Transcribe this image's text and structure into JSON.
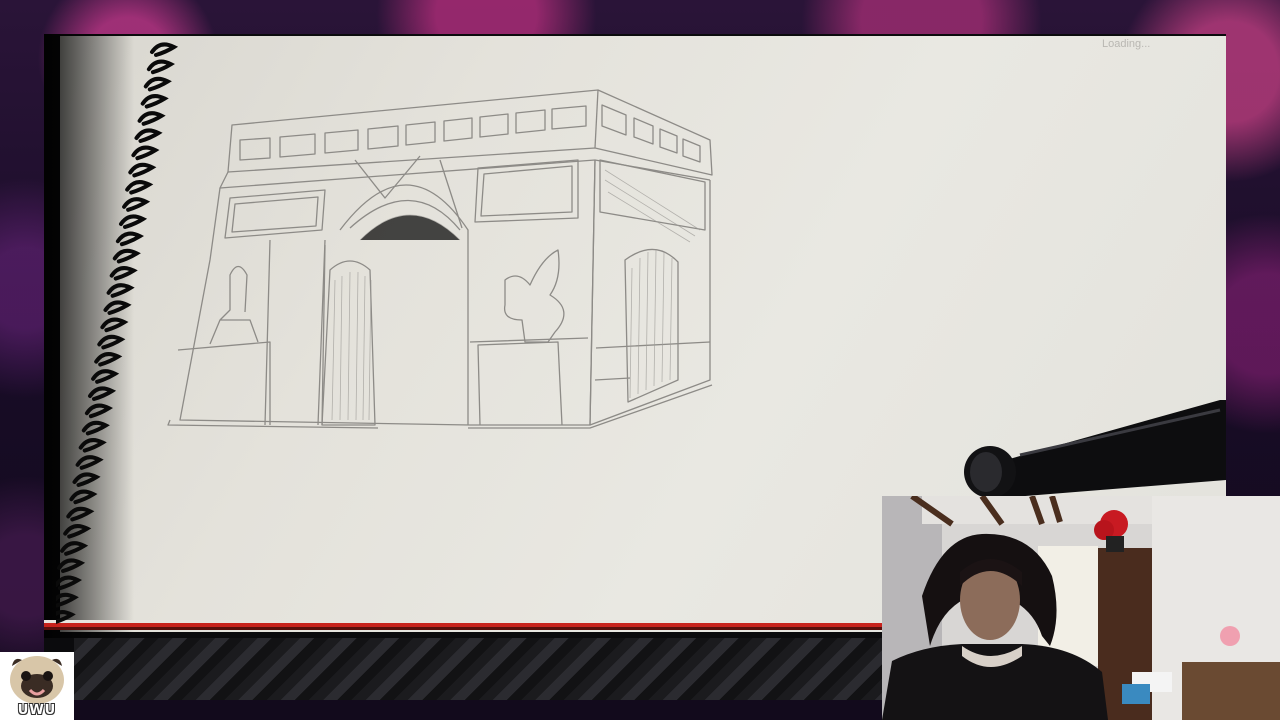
{
  "stream": {
    "loading_text": "Loading...",
    "avatar_label": "UWU"
  },
  "colors": {
    "accent_red": "#c8221c",
    "paper": "#e6e4de",
    "frame": "#0b0b0d"
  },
  "icons": {
    "avatar": "pug-emote-icon",
    "microphone": "microphone-icon"
  }
}
